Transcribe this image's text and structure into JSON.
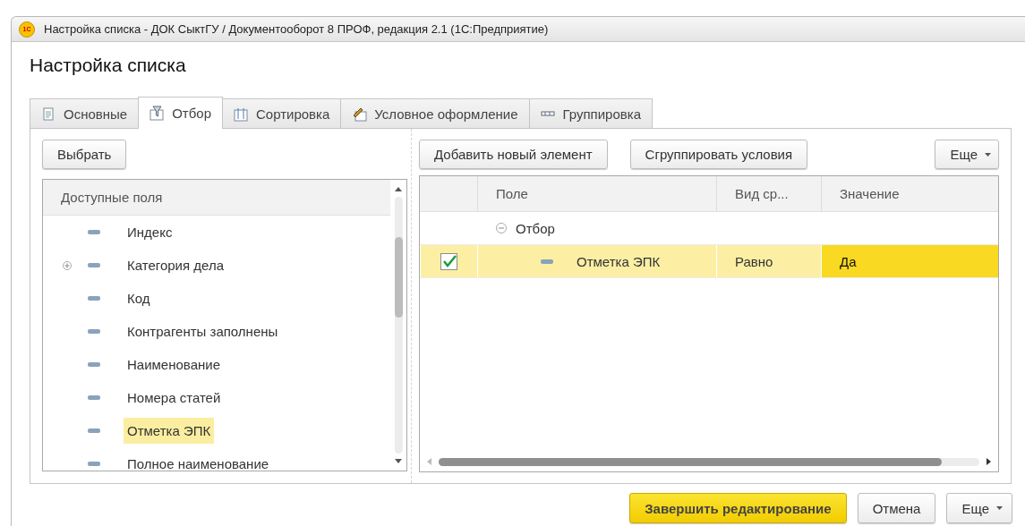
{
  "window": {
    "title": "Настройка списка - ДОК СыктГУ / Документооборот 8 ПРОФ, редакция 2.1  (1С:Предприятие)",
    "logo": "1С"
  },
  "heading": "Настройка списка",
  "tabs": [
    {
      "label": "Основные",
      "selected": false
    },
    {
      "label": "Отбор",
      "selected": true
    },
    {
      "label": "Сортировка",
      "selected": false
    },
    {
      "label": "Условное оформление",
      "selected": false
    },
    {
      "label": "Группировка",
      "selected": false
    }
  ],
  "fields_panel": {
    "select_button": "Выбрать",
    "header": "Доступные поля",
    "items": [
      {
        "label": "Индекс",
        "expandable": false,
        "selected": false
      },
      {
        "label": "Категория дела",
        "expandable": true,
        "selected": false
      },
      {
        "label": "Код",
        "expandable": false,
        "selected": false
      },
      {
        "label": "Контрагенты заполнены",
        "expandable": false,
        "selected": false
      },
      {
        "label": "Наименование",
        "expandable": false,
        "selected": false
      },
      {
        "label": "Номера статей",
        "expandable": false,
        "selected": false
      },
      {
        "label": "Отметка ЭПК",
        "expandable": false,
        "selected": true
      },
      {
        "label": "Полное наименование",
        "expandable": false,
        "selected": false
      }
    ]
  },
  "filter_panel": {
    "buttons": [
      "Добавить новый элемент",
      "Сгруппировать условия"
    ],
    "more_button": "Еще",
    "columns": [
      "Поле",
      "Вид ср...",
      "Значение"
    ],
    "rows": [
      {
        "label": "Отбор",
        "expanded": true,
        "children": [
          {
            "checked": true,
            "field": "Отметка ЭПК",
            "comparison": "Равно",
            "value": "Да",
            "selected": true
          }
        ]
      }
    ]
  },
  "footer_buttons": [
    {
      "label": "Завершить редактирование",
      "kind": "primary"
    },
    {
      "label": "Отмена",
      "kind": "plain"
    },
    {
      "label": "Еще",
      "kind": "menu"
    }
  ]
}
